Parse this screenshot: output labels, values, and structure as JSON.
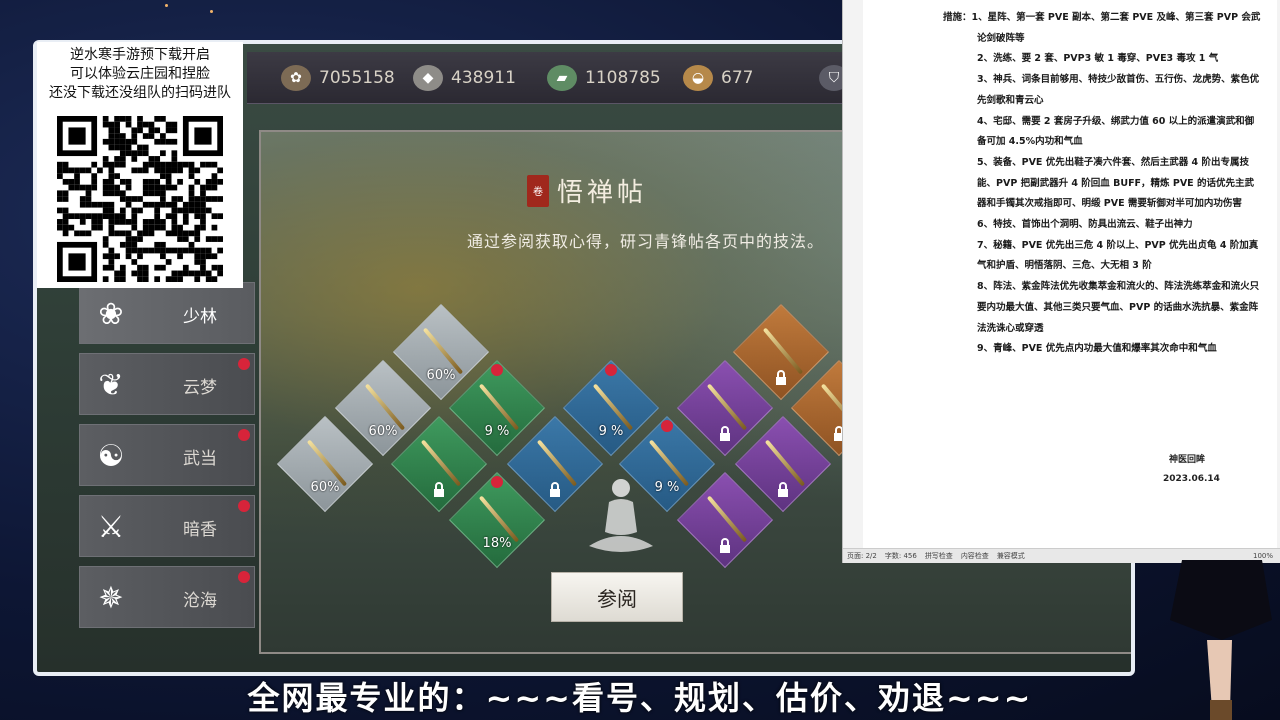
{
  "promo": {
    "lines": [
      "逆水寒手游预下载开启",
      "可以体验云庄园和捏脸",
      "还没下载还没组队的扫码进队"
    ]
  },
  "resources": [
    {
      "icon": "coin-icon",
      "value": "7055158"
    },
    {
      "icon": "ingot-icon",
      "value": "438911"
    },
    {
      "icon": "jade-icon",
      "value": "1108785"
    },
    {
      "icon": "gold-bowl-icon",
      "value": "677"
    }
  ],
  "scene": {
    "title": "悟禅帖",
    "seal_text": "卷",
    "subtitle": "通过参阅获取心得，研习青锋帖各页中的技法。",
    "read_button": "参阅"
  },
  "tiles": [
    {
      "color": "grey",
      "pct": "60%",
      "locked": false,
      "dot": false
    },
    {
      "color": "grey",
      "pct": "60%",
      "locked": false,
      "dot": false
    },
    {
      "color": "grey",
      "pct": "60%",
      "locked": false,
      "dot": false
    },
    {
      "color": "green",
      "pct": "9 %",
      "locked": false,
      "dot": true
    },
    {
      "color": "green",
      "pct": "",
      "locked": true,
      "dot": false
    },
    {
      "color": "green",
      "pct": "18%",
      "locked": false,
      "dot": true
    },
    {
      "color": "blue",
      "pct": "9 %",
      "locked": false,
      "dot": true
    },
    {
      "color": "blue",
      "pct": "",
      "locked": true,
      "dot": false
    },
    {
      "color": "blue",
      "pct": "9 %",
      "locked": false,
      "dot": true
    },
    {
      "color": "purple",
      "pct": "",
      "locked": true,
      "dot": false
    },
    {
      "color": "purple",
      "pct": "",
      "locked": true,
      "dot": false
    },
    {
      "color": "purple",
      "pct": "",
      "locked": true,
      "dot": false
    },
    {
      "color": "orange",
      "pct": "",
      "locked": true,
      "dot": false
    },
    {
      "color": "orange",
      "pct": "",
      "locked": true,
      "dot": false
    }
  ],
  "sects": [
    {
      "label": "少林",
      "active": true,
      "dot": false,
      "emblem": "shaolin-emblem-icon"
    },
    {
      "label": "云梦",
      "active": false,
      "dot": true,
      "emblem": "butterfly-emblem-icon"
    },
    {
      "label": "武当",
      "active": false,
      "dot": true,
      "emblem": "taiji-emblem-icon"
    },
    {
      "label": "暗香",
      "active": false,
      "dot": true,
      "emblem": "crossed-blades-emblem-icon"
    },
    {
      "label": "沧海",
      "active": false,
      "dot": true,
      "emblem": "wheel-emblem-icon"
    }
  ],
  "doc": {
    "paragraphs": [
      "措施：1、星阵、第一套 PVE 副本、第二套 PVE 及峰、第三套 PVP 会武论剑破阵等",
      "2、洗练、要 2 套、PVP3 敏 1 毒穿、PVE3 毒攻 1 气",
      "3、神兵、词条目前够用、特技少敌首伤、五行伤、龙虎势、紫色优先剑歌和青云心",
      "4、宅邸、需要 2 套房子升级、绑武力值 60 以上的派遣演武和御备可加 4.5%内功和气血",
      "5、装备、PVE 优先出鞋子凑六件套、然后主武器 4 阶出专属技能、PVP 把副武器升 4 阶回血 BUFF，精炼 PVE 的话优先主武器和手镯其次戒指即可、明缎 PVE 需要斩御对半可加内功伤害",
      "6、特技、首饰出个洞明、防具出流云、鞋子出神力",
      "7、秘籍、PVE 优先出三危 4 阶以上、PVP 优先出贞龟 4 阶加真气和护盾、明悟落阴、三危、大无相 3 阶",
      "8、阵法、紫金阵法优先收集萃金和流火的、阵法洗练萃金和流火只要内功最大值、其他三类只要气血、PVP 的话曲水洗抗暴、紫金阵法洗诛心或穿透",
      "9、青峰、PVE 优先点内功最大值和爆率其次命中和气血"
    ],
    "signature": "神医回眸",
    "date": "2023.06.14",
    "status": [
      "页面: 2/2",
      "字数: 456",
      "拼写检查",
      "内容检查",
      "兼容模式",
      "100%"
    ]
  },
  "banner": "全网最专业的：~~~看号、规划、估价、劝退~~~"
}
